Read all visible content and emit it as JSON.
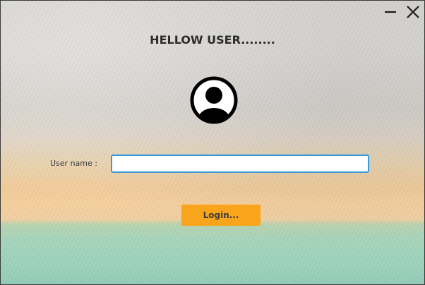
{
  "window": {
    "minimize_icon": "minimize-icon",
    "close_icon": "close-icon"
  },
  "header": {
    "title": "HELLOW USER........"
  },
  "avatar": {
    "icon": "user-avatar-icon"
  },
  "form": {
    "username_label": "User name :",
    "username_value": "",
    "login_label": "Login..."
  },
  "colors": {
    "accent_button": "#f9a51b",
    "input_border": "#3a9ad9",
    "title_text": "#2b2b2b"
  }
}
